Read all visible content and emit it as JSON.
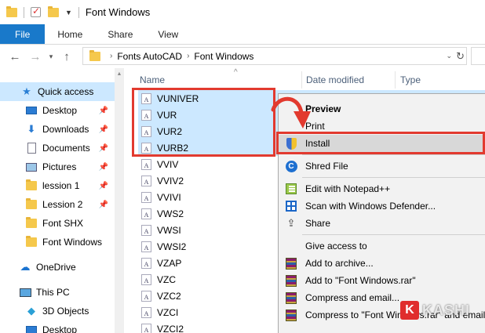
{
  "window": {
    "title": "Font Windows"
  },
  "ribbon": {
    "tabs": [
      "File",
      "Home",
      "Share",
      "View"
    ]
  },
  "address": {
    "crumbs": [
      "Fonts AutoCAD",
      "Font Windows"
    ]
  },
  "nav": {
    "items": [
      {
        "label": "Quick access",
        "icon": "star-icon"
      },
      {
        "label": "Desktop",
        "icon": "desktop-icon"
      },
      {
        "label": "Downloads",
        "icon": "download-icon"
      },
      {
        "label": "Documents",
        "icon": "documents-icon"
      },
      {
        "label": "Pictures",
        "icon": "pictures-icon"
      },
      {
        "label": "lession 1",
        "icon": "folder-icon"
      },
      {
        "label": "Lession 2",
        "icon": "folder-icon"
      },
      {
        "label": "Font SHX",
        "icon": "folder-icon"
      },
      {
        "label": "Font Windows",
        "icon": "folder-icon"
      },
      {
        "label": "OneDrive",
        "icon": "cloud-icon"
      },
      {
        "label": "This PC",
        "icon": "computer-icon"
      },
      {
        "label": "3D Objects",
        "icon": "cube-icon"
      },
      {
        "label": "Desktop",
        "icon": "desktop-icon"
      }
    ]
  },
  "columns": {
    "name": "Name",
    "date": "Date modified",
    "type": "Type"
  },
  "files": [
    {
      "name": "VUNIVER",
      "selected": true
    },
    {
      "name": "VUR",
      "selected": true
    },
    {
      "name": "VUR2",
      "selected": true
    },
    {
      "name": "VURB2",
      "selected": true
    },
    {
      "name": "VVIV",
      "selected": false
    },
    {
      "name": "VVIV2",
      "selected": false
    },
    {
      "name": "VVIVI",
      "selected": false
    },
    {
      "name": "VWS2",
      "selected": false
    },
    {
      "name": "VWSI",
      "selected": false
    },
    {
      "name": "VWSI2",
      "selected": false
    },
    {
      "name": "VZAP",
      "selected": false
    },
    {
      "name": "VZC",
      "selected": false
    },
    {
      "name": "VZC2",
      "selected": false
    },
    {
      "name": "VZCI",
      "selected": false
    },
    {
      "name": "VZCI2",
      "selected": false
    }
  ],
  "context_menu": {
    "items": [
      {
        "label": "Preview",
        "bold": true,
        "icon": ""
      },
      {
        "label": "Print",
        "bold": false,
        "icon": ""
      },
      {
        "label": "Install",
        "bold": false,
        "icon": "shield-icon",
        "highlight": true
      },
      {
        "label": "Shred File",
        "bold": false,
        "icon": "shred-icon"
      },
      {
        "label": "Edit with Notepad++",
        "bold": false,
        "icon": "notepad-icon"
      },
      {
        "label": "Scan with Windows Defender...",
        "bold": false,
        "icon": "defender-icon"
      },
      {
        "label": "Share",
        "bold": false,
        "icon": "share-icon"
      },
      {
        "label": "Give access to",
        "bold": false,
        "icon": ""
      },
      {
        "label": "Add to archive...",
        "bold": false,
        "icon": "rar-icon"
      },
      {
        "label": "Add to \"Font Windows.rar\"",
        "bold": false,
        "icon": "rar-icon"
      },
      {
        "label": "Compress and email...",
        "bold": false,
        "icon": "rar-icon"
      },
      {
        "label": "Compress to \"Font Windows.rar\" and email",
        "bold": false,
        "icon": "rar-icon"
      }
    ]
  },
  "watermark": {
    "letter": "K",
    "text": "KASHI"
  },
  "colors": {
    "accent": "#1979ca",
    "selection": "#cce8ff",
    "highlight_box": "#e23a2f"
  }
}
